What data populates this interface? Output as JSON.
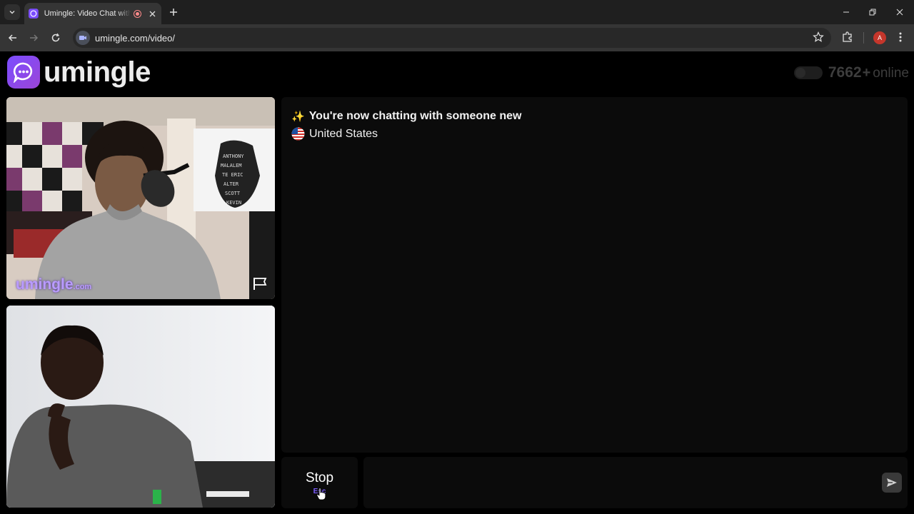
{
  "browser": {
    "tab_title": "Umingle: Video Chat with Strangers",
    "url": "umingle.com/video/",
    "profile_initial": "A"
  },
  "header": {
    "logo_text": "umingle",
    "online_count": "7662",
    "online_plus": "+",
    "online_label": "online"
  },
  "videos": {
    "watermark": "umingle",
    "watermark_tld": ".com"
  },
  "chat": {
    "status_emoji": "✨",
    "status_text": "You're now chatting with someone new",
    "country_flag": "🇺🇸",
    "country": "United States"
  },
  "controls": {
    "stop_label": "Stop",
    "stop_hint": "Esc",
    "message_placeholder": ""
  },
  "colors": {
    "brand": "#7b4dff",
    "background": "#000000",
    "panel": "#0b0b0b"
  }
}
